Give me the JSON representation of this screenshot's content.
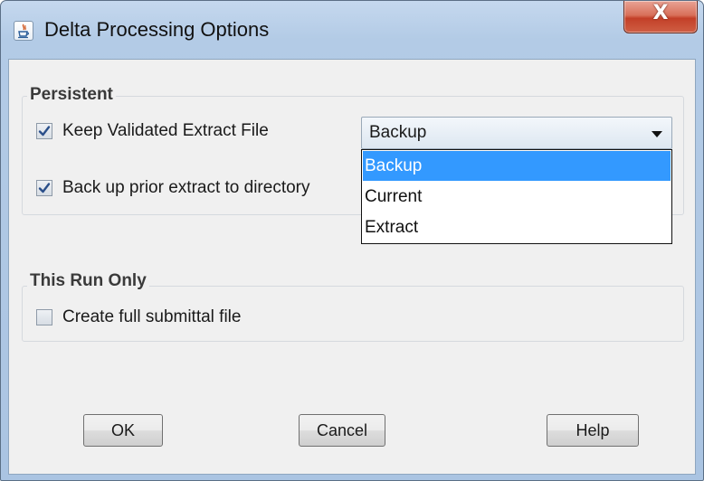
{
  "window": {
    "title": "Delta Processing Options",
    "close_symbol": "X",
    "app_icon": "java-app-icon"
  },
  "persistent": {
    "title": "Persistent",
    "keep_validated": {
      "label": "Keep Validated Extract File",
      "checked": true
    },
    "backup_prior": {
      "label": "Back up prior extract to directory",
      "checked": true
    },
    "directory_combo": {
      "selected": "Backup",
      "options": [
        "Backup",
        "Current",
        "Extract"
      ],
      "highlighted": "Backup",
      "expanded": true
    }
  },
  "this_run_only": {
    "title": "This Run Only",
    "create_full": {
      "label": "Create full submittal file",
      "checked": false
    }
  },
  "buttons": {
    "ok": "OK",
    "cancel": "Cancel",
    "help": "Help"
  },
  "colors": {
    "selection": "#3399ff",
    "close_button": "#c34028",
    "dialog_background": "#f0f0f0"
  }
}
